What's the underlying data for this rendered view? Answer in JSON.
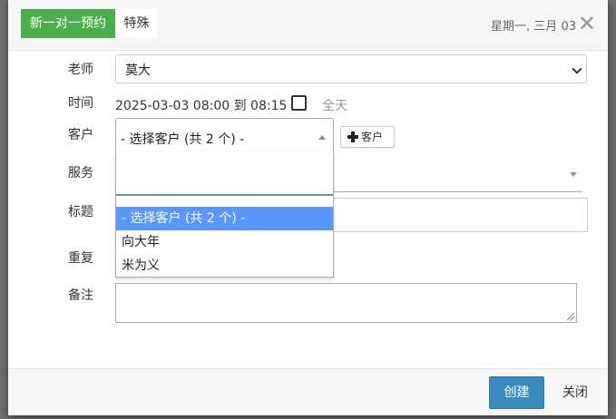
{
  "header": {
    "tabs": [
      {
        "label": "新一对一预约",
        "active": true
      },
      {
        "label": "特殊",
        "active": false
      }
    ],
    "date": "星期一, 三月 03",
    "close_symbol": "✕"
  },
  "form": {
    "teacher": {
      "label": "老师",
      "value": "莫大"
    },
    "time": {
      "label": "时间",
      "value": "2025-03-03 08:00 到 08:15",
      "all_day_label": "全天",
      "all_day_checked": false
    },
    "client": {
      "label": "客户",
      "value": "- 选择客户 (共 2 个) -",
      "add_button_label": "客户"
    },
    "service": {
      "label": "服务"
    },
    "title": {
      "label": "标题"
    },
    "repeat": {
      "label": "重复"
    },
    "notes": {
      "label": "备注",
      "value": ""
    }
  },
  "client_dropdown": {
    "search_value": "",
    "options": [
      {
        "label": "- 选择客户 (共 2 个) -",
        "highlighted": true
      },
      {
        "label": "向大年",
        "highlighted": false
      },
      {
        "label": "米为义",
        "highlighted": false
      }
    ]
  },
  "footer": {
    "create_label": "创建",
    "close_label": "关闭"
  },
  "colors": {
    "active_tab": "#4cae4c",
    "primary_button": "#3a8cc0",
    "highlight": "#5897fb"
  }
}
